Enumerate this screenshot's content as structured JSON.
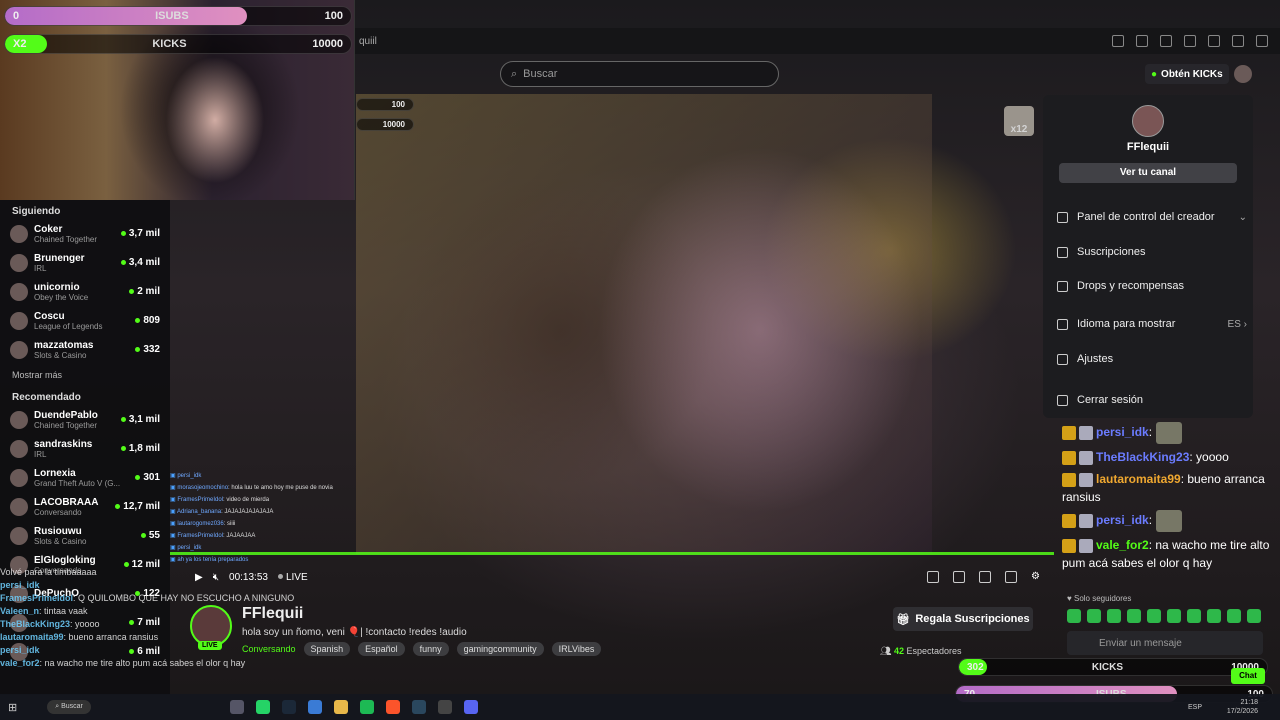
{
  "overlay": {
    "subs_goal": {
      "label": "ISUBS",
      "value": "100",
      "left": "0"
    },
    "kicks_goal": {
      "label": "KICKS",
      "value": "10000",
      "left": "X2"
    },
    "mini_subs": "100",
    "mini_kicks": "10000",
    "cat_label": "x12",
    "bottom_kicks": {
      "label": "KICKS",
      "value": "10000",
      "left": "302"
    },
    "bottom_subs": {
      "label": "ISUBS",
      "value": "100",
      "left": "70"
    }
  },
  "browser": {
    "tab_fragment": "quiil"
  },
  "search": {
    "placeholder": "Buscar"
  },
  "kicks_button": "Obtén KICKs",
  "sidebar": {
    "following_title": "Siguiendo",
    "following": [
      {
        "name": "Coker",
        "category": "Chained Together",
        "viewers": "3,7 mil"
      },
      {
        "name": "Brunenger",
        "category": "IRL",
        "viewers": "3,4 mil"
      },
      {
        "name": "unicornio",
        "category": "Obey the Voice",
        "viewers": "2 mil"
      },
      {
        "name": "Coscu",
        "category": "League of Legends",
        "viewers": "809"
      },
      {
        "name": "mazzatomas",
        "category": "Slots & Casino",
        "viewers": "332"
      }
    ],
    "show_more": "Mostrar más",
    "recommended_title": "Recomendado",
    "recommended": [
      {
        "name": "DuendePablo",
        "category": "Chained Together",
        "viewers": "3,1 mil"
      },
      {
        "name": "sandraskins",
        "category": "IRL",
        "viewers": "1,8 mil"
      },
      {
        "name": "Lornexia",
        "category": "Grand Theft Auto V (G...",
        "viewers": "301"
      },
      {
        "name": "LACOBRAAA",
        "category": "Conversando",
        "viewers": "12,7 mil"
      },
      {
        "name": "Rusiouwu",
        "category": "Slots & Casino",
        "viewers": "55"
      },
      {
        "name": "ElGlogloking",
        "category": "Conversando",
        "viewers": "12 mil"
      },
      {
        "name": "DePuchO",
        "category": "",
        "viewers": "122"
      },
      {
        "name": "",
        "category": "",
        "viewers": "7 mil"
      },
      {
        "name": "",
        "category": "",
        "viewers": "6 mil"
      }
    ]
  },
  "overlay_chat": [
    {
      "user": "persi_idk",
      "text": ""
    },
    {
      "user": "morasojeomochino",
      "text": ": hola luu te amo hoy me puse de novia"
    },
    {
      "user": "FramesPrimeIdol",
      "text": ": video de mierda"
    },
    {
      "user": "Adriana_banana",
      "text": ": JAJAJAJAJAJAJA"
    },
    {
      "user": "lautarogomez036",
      "text": ": siiii"
    },
    {
      "user": "FramesPrimeIdol",
      "text": ": JAJAAJAA"
    },
    {
      "user": "persi_idk",
      "text": ""
    },
    {
      "user": "ah ya los tenía preparados",
      "text": ""
    }
  ],
  "ghost_chat": [
    {
      "user": "",
      "text": "Volvé para la timbaaaaa"
    },
    {
      "user": "persi_idk",
      "text": ""
    },
    {
      "user": "FramesPrimeIdol",
      "text": ": Q QUILOMBO QUE HAY NO ESCUCHO A NINGUNO"
    },
    {
      "user": "Valeen_n",
      "text": ": tintaa vaak"
    },
    {
      "user": "TheBlackKing23",
      "text": ": yoooo"
    },
    {
      "user": "lautaromaita99",
      "text": ": bueno arranca ransius"
    },
    {
      "user": "persi_idk",
      "text": ""
    },
    {
      "user": "vale_for2",
      "text": ": na wacho me tire alto pum acá sabes el olor q hay"
    }
  ],
  "player": {
    "time": "00:13:53",
    "live": "LIVE"
  },
  "stream": {
    "streamer": "FFlequii",
    "live_badge": "LIVE",
    "title": "hola soy un ñomo, veni 🎈| !contacto !redes !audio",
    "category": "Conversando",
    "tags": [
      "Spanish",
      "Español",
      "funny",
      "gamingcommunity",
      "IRLVibes"
    ],
    "gift_button": "Regala Suscripciones",
    "viewers_count": "42",
    "viewers_label": "Espectadores"
  },
  "user_menu": {
    "username": "FFlequii",
    "channel_button": "Ver tu canal",
    "items": [
      {
        "label": "Panel de control del creador",
        "right": "⌄"
      },
      {
        "label": "Suscripciones",
        "right": ""
      },
      {
        "label": "Drops y recompensas",
        "right": ""
      },
      {
        "label": "Idioma para mostrar",
        "right": "ES ›"
      },
      {
        "label": "Ajustes",
        "right": ""
      },
      {
        "label": "Cerrar sesión",
        "right": ""
      }
    ]
  },
  "chat": [
    {
      "user": "persi_idk",
      "sep": ":",
      "text": "",
      "color": "blue"
    },
    {
      "user": "TheBlackKing23",
      "sep": ":",
      "text": " yoooo",
      "color": "blue"
    },
    {
      "user": "lautaromaita99",
      "sep": ":",
      "text": " bueno arranca ransius",
      "color": "gold"
    },
    {
      "user": "persi_idk",
      "sep": ":",
      "text": "",
      "color": "blue"
    },
    {
      "user": "vale_for2",
      "sep": ":",
      "text": " na wacho me tire alto pum acá sabes el olor q hay",
      "color": "green"
    }
  ],
  "chat_footer": {
    "followers_only": "Solo seguidores",
    "input_placeholder": "Enviar un mensaje",
    "send_button": "Chat"
  },
  "taskbar": {
    "search": "Buscar",
    "lang": "ESP",
    "time": "21:18",
    "date": "17/2/2026"
  }
}
